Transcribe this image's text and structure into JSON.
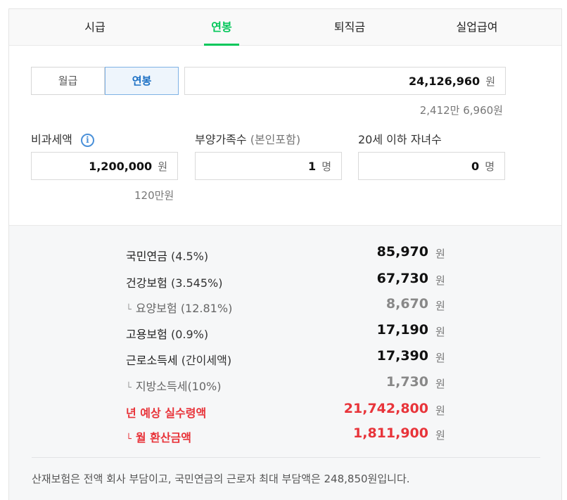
{
  "tabs": [
    {
      "label": "시급",
      "active": false
    },
    {
      "label": "연봉",
      "active": true
    },
    {
      "label": "퇴직금",
      "active": false
    },
    {
      "label": "실업급여",
      "active": false
    }
  ],
  "pay_type": {
    "monthly_label": "월급",
    "annual_label": "연봉",
    "selected": "연봉"
  },
  "salary": {
    "value": "24,126,960",
    "unit": "원",
    "korean": "2,412만 6,960원"
  },
  "nontax": {
    "label": "비과세액",
    "info_icon": "i",
    "value": "1,200,000",
    "unit": "원",
    "korean": "120만원"
  },
  "dependents": {
    "label": "부양가족수",
    "label_note": "(본인포함)",
    "value": "1",
    "unit": "명"
  },
  "children": {
    "label": "20세 이하 자녀수",
    "value": "0",
    "unit": "명"
  },
  "result": {
    "currency": "원",
    "tree_mark": "└",
    "rows": [
      {
        "name": "국민연금",
        "rate": "(4.5%)",
        "amount": "85,970"
      },
      {
        "name": "건강보험",
        "rate": "(3.545%)",
        "amount": "67,730"
      },
      {
        "name": "요양보험",
        "rate": "(12.81%)",
        "amount": "8,670"
      },
      {
        "name": "고용보험",
        "rate": "(0.9%)",
        "amount": "17,190"
      },
      {
        "name": "근로소득세",
        "rate": "(간이세액)",
        "amount": "17,390"
      },
      {
        "name": "지방소득세",
        "rate": "(10%)",
        "amount": "1,730"
      },
      {
        "name": "년 예상 실수령액",
        "rate": "",
        "amount": "21,742,800"
      },
      {
        "name": "월 환산금액",
        "rate": "",
        "amount": "1,811,900"
      }
    ],
    "note": "산재보험은 전액 회사 부담이고, 국민연금의 근로자 최대 부담액은 248,850원입니다."
  },
  "colors": {
    "accent_green": "#03c75a",
    "selected_blue": "#1a6fc4",
    "highlight_red": "#e8343a"
  }
}
